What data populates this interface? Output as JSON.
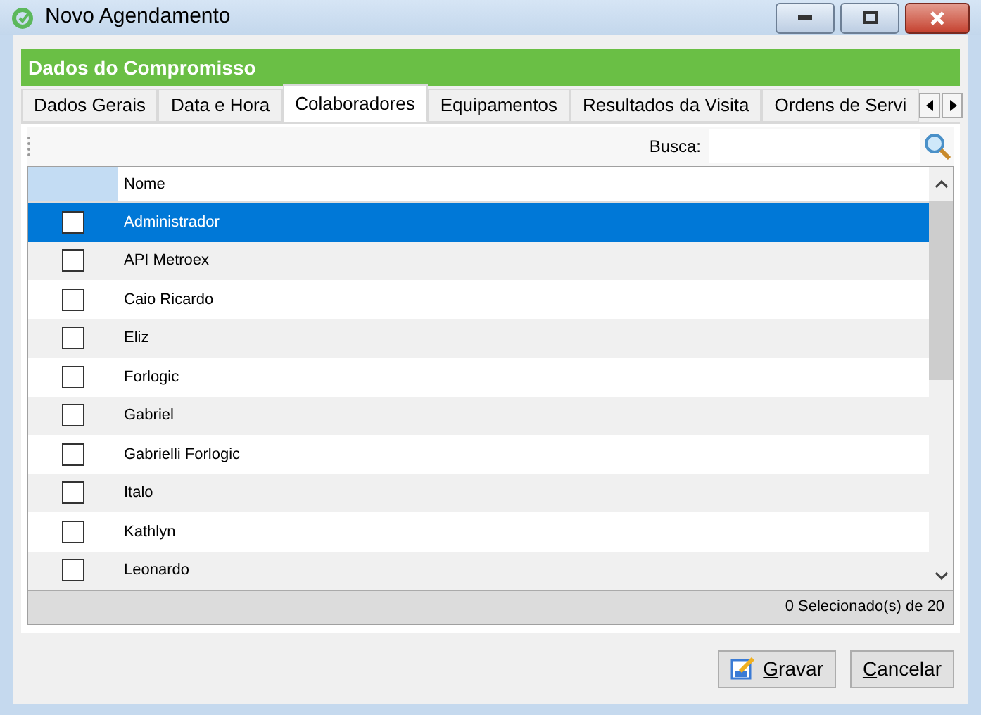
{
  "window": {
    "title": "Novo Agendamento"
  },
  "section_title": "Dados do Compromisso",
  "tabs": [
    {
      "label": "Dados Gerais",
      "selected": false
    },
    {
      "label": "Data e Hora",
      "selected": false
    },
    {
      "label": "Colaboradores",
      "selected": true
    },
    {
      "label": "Equipamentos",
      "selected": false
    },
    {
      "label": "Resultados da Visita",
      "selected": false
    },
    {
      "label": "Ordens de Servi",
      "selected": false
    }
  ],
  "search": {
    "label": "Busca:"
  },
  "table": {
    "columns": [
      "Nome"
    ],
    "rows": [
      {
        "name": "Administrador",
        "checked": false,
        "selected": true
      },
      {
        "name": "API Metroex",
        "checked": false,
        "selected": false
      },
      {
        "name": "Caio Ricardo",
        "checked": false,
        "selected": false
      },
      {
        "name": "Eliz",
        "checked": false,
        "selected": false
      },
      {
        "name": "Forlogic",
        "checked": false,
        "selected": false
      },
      {
        "name": "Gabriel",
        "checked": false,
        "selected": false
      },
      {
        "name": "Gabrielli Forlogic",
        "checked": false,
        "selected": false
      },
      {
        "name": "Italo",
        "checked": false,
        "selected": false
      },
      {
        "name": "Kathlyn",
        "checked": false,
        "selected": false
      },
      {
        "name": "Leonardo",
        "checked": false,
        "selected": false
      }
    ]
  },
  "status": "0 Selecionado(s) de 20",
  "buttons": [
    {
      "label": "Gravar",
      "kind": "save"
    },
    {
      "label": "Cancelar",
      "kind": "cancel"
    }
  ]
}
